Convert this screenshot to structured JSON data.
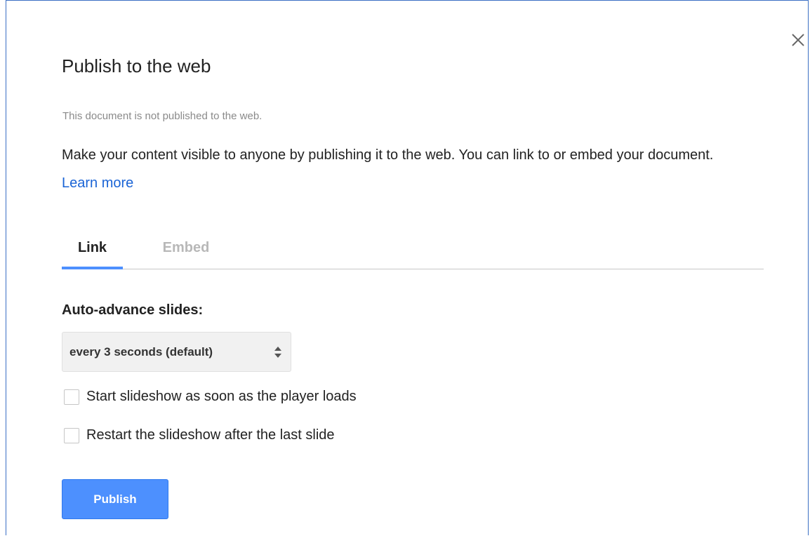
{
  "dialog": {
    "title": "Publish to the web",
    "status": "This document is not published to the web.",
    "description": "Make your content visible to anyone by publishing it to the web. You can link to or embed your document.",
    "learn_more": "Learn more"
  },
  "tabs": [
    {
      "label": "Link",
      "active": true
    },
    {
      "label": "Embed",
      "active": false
    }
  ],
  "settings": {
    "auto_advance_label": "Auto-advance slides:",
    "auto_advance_value": "every 3 seconds (default)",
    "start_on_load_label": "Start slideshow as soon as the player loads",
    "start_on_load_checked": false,
    "restart_label": "Restart the slideshow after the last slide",
    "restart_checked": false
  },
  "actions": {
    "publish_label": "Publish"
  },
  "colors": {
    "accent": "#4d90fe",
    "link": "#1a64d6",
    "muted": "#8a8a8a"
  }
}
